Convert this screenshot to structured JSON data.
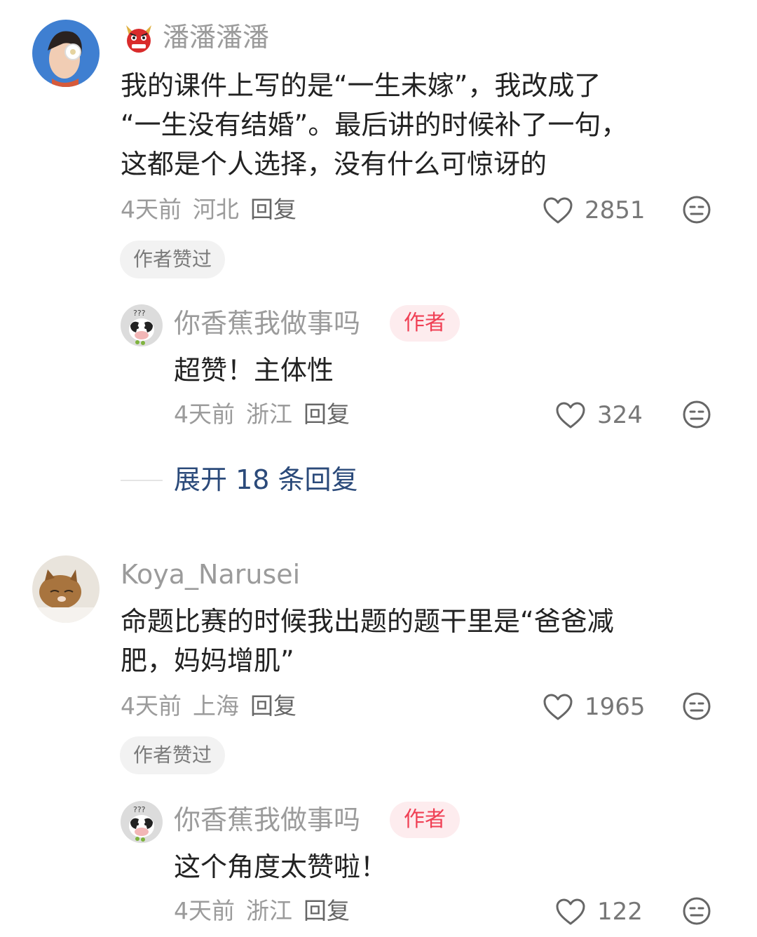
{
  "comments": [
    {
      "username": "潘潘潘潘",
      "avatar": "woman-portrait-avatar",
      "badge": "red-demon-icon",
      "text_lines": [
        "我的课件上写的是“一生未嫁”，我改成了",
        "“一生没有结婚”。最后讲的时候补了一句，",
        "这都是个人选择，没有什么可惊讶的"
      ],
      "time": "4天前",
      "location": "河北",
      "reply_label": "回复",
      "likes": "2851",
      "author_liked_label": "作者赞过",
      "reply": {
        "username": "你香蕉我做事吗",
        "avatar": "cow-avatar",
        "author_tag": "作者",
        "text": "超赞！主体性",
        "time": "4天前",
        "location": "浙江",
        "reply_label": "回复",
        "likes": "324"
      },
      "expand_label": "展开 18 条回复"
    },
    {
      "username": "Koya_Narusei",
      "avatar": "cat-avatar",
      "text_lines": [
        "命题比赛的时候我出题的题干里是“爸爸减",
        "肥，妈妈增肌”"
      ],
      "time": "4天前",
      "location": "上海",
      "reply_label": "回复",
      "likes": "1965",
      "author_liked_label": "作者赞过",
      "reply": {
        "username": "你香蕉我做事吗",
        "avatar": "cow-avatar",
        "author_tag": "作者",
        "text": "这个角度太赞啦！",
        "time": "4天前",
        "location": "浙江",
        "reply_label": "回复",
        "likes": "122"
      }
    }
  ],
  "colors": {
    "author_tag_bg": "#fdecee",
    "author_tag_text": "#f04055",
    "expand_link": "#2b4a7a",
    "meta_text": "#9b9b9b"
  }
}
